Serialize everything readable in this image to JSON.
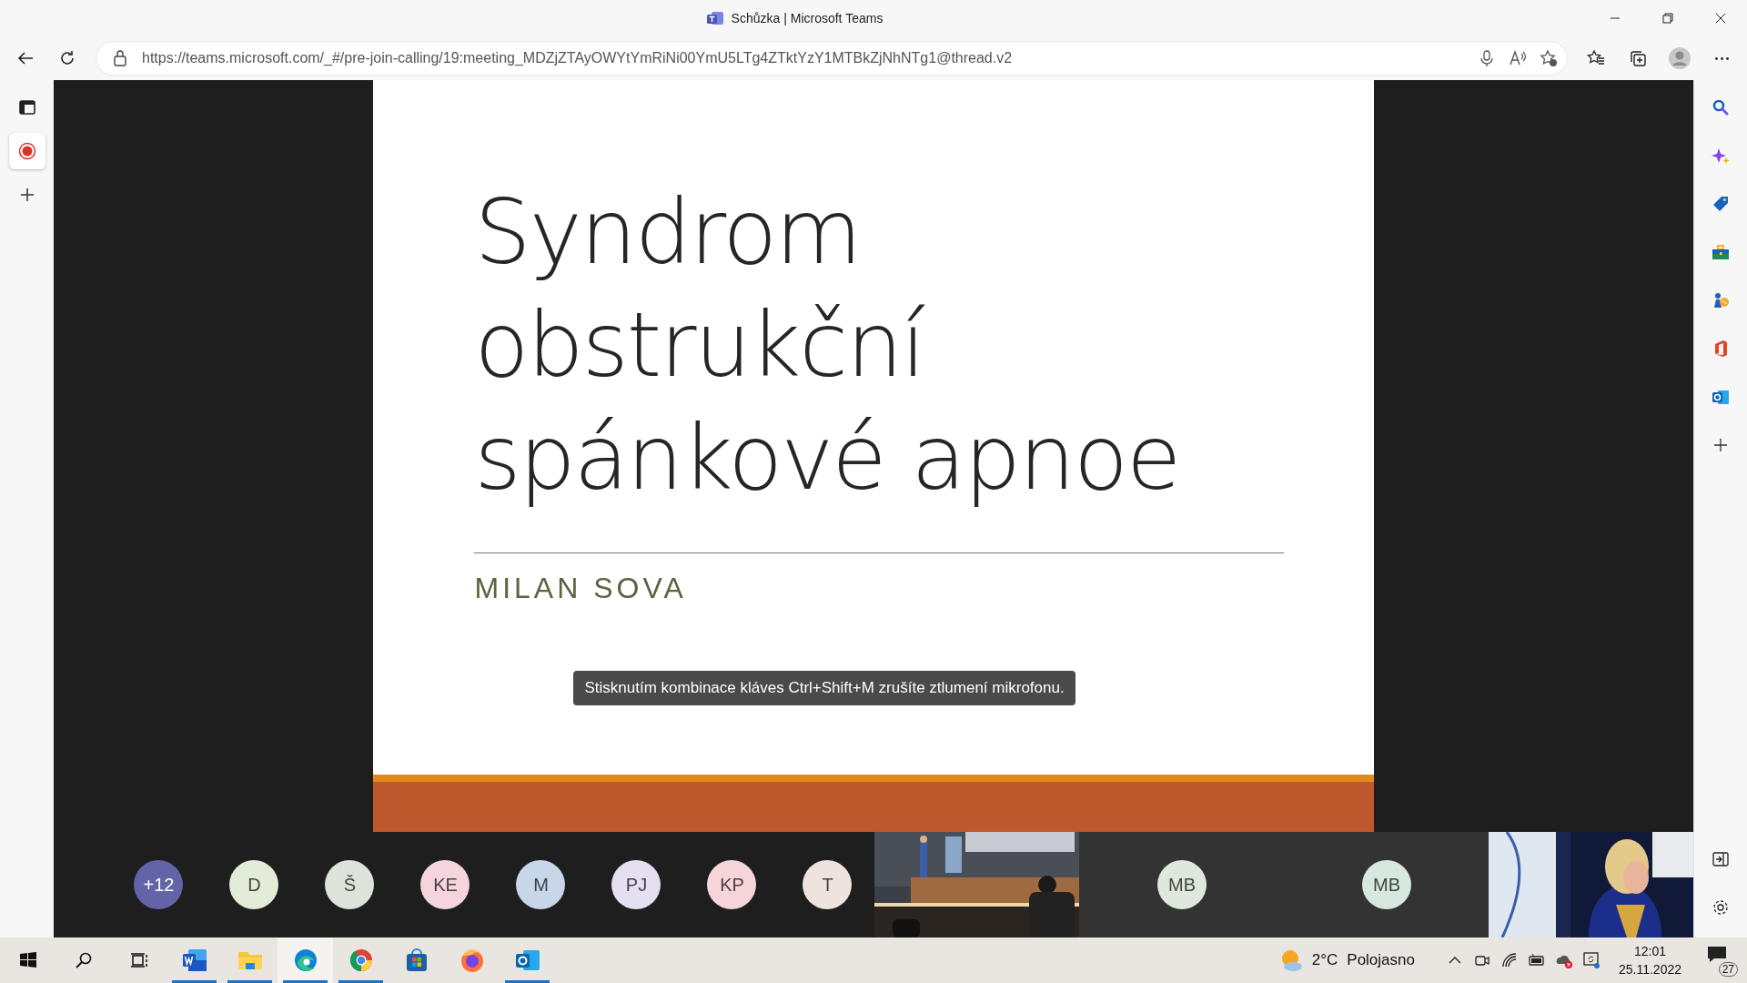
{
  "window": {
    "title": "Schůzka | Microsoft Teams"
  },
  "address_bar": {
    "url": "https://teams.microsoft.com/_#/pre-join-calling/19:meeting_MDZjZTAyOWYtYmRiNi00YmU5LTg4ZTktYzY1MTBkZjNhNTg1@thread.v2"
  },
  "left_sidebar": {
    "items": [
      {
        "kind": "panel",
        "selected": false
      },
      {
        "kind": "record",
        "selected": true
      },
      {
        "kind": "add",
        "selected": false
      }
    ]
  },
  "slide": {
    "title_lines": [
      "Syndrom",
      "obstrukční",
      "spánkové apnoe"
    ],
    "author": "MILAN SOVA"
  },
  "tooltip": "Stisknutím kombinace kláves Ctrl+Shift+M zrušíte ztlumení mikrofonu.",
  "participants": [
    {
      "initials": "+12",
      "color": "#6264a7"
    },
    {
      "initials": "D",
      "color": "#e3ecd8"
    },
    {
      "initials": "Š",
      "color": "#dde3da"
    },
    {
      "initials": "KE",
      "color": "#f5d4de"
    },
    {
      "initials": "M",
      "color": "#c8d6ea"
    },
    {
      "initials": "PJ",
      "color": "#e4e0f1"
    },
    {
      "initials": "KP",
      "color": "#f5d5d9"
    },
    {
      "initials": "T",
      "color": "#eee3de"
    }
  ],
  "video_tiles": [
    {
      "kind": "picture"
    },
    {
      "kind": "avatar",
      "initials": "MB",
      "color": "#dfe8dc"
    },
    {
      "kind": "avatar",
      "initials": "MB",
      "color": "#d6e8df"
    },
    {
      "kind": "picture"
    }
  ],
  "right_sidebar": {
    "items": [
      {
        "kind": "search"
      },
      {
        "kind": "sparkle"
      },
      {
        "kind": "tag"
      },
      {
        "kind": "toolbox"
      },
      {
        "kind": "games"
      },
      {
        "kind": "office"
      },
      {
        "kind": "outlook"
      },
      {
        "kind": "add"
      }
    ]
  },
  "taskbar": {
    "apps": [
      {
        "kind": "start",
        "running": false,
        "selected": false
      },
      {
        "kind": "search",
        "running": false,
        "selected": false
      },
      {
        "kind": "taskview",
        "running": false,
        "selected": false
      },
      {
        "kind": "word",
        "running": true,
        "selected": false
      },
      {
        "kind": "explorer",
        "running": true,
        "selected": false
      },
      {
        "kind": "edge",
        "running": true,
        "selected": true
      },
      {
        "kind": "chrome",
        "running": true,
        "selected": false
      },
      {
        "kind": "store",
        "running": false,
        "selected": false
      },
      {
        "kind": "firefox",
        "running": false,
        "selected": false
      },
      {
        "kind": "outlook",
        "running": true,
        "selected": false
      }
    ],
    "temperature": "2°C",
    "weather": "Polojasno",
    "time": "12:01",
    "date": "25.11.2022",
    "notifications": "27"
  }
}
